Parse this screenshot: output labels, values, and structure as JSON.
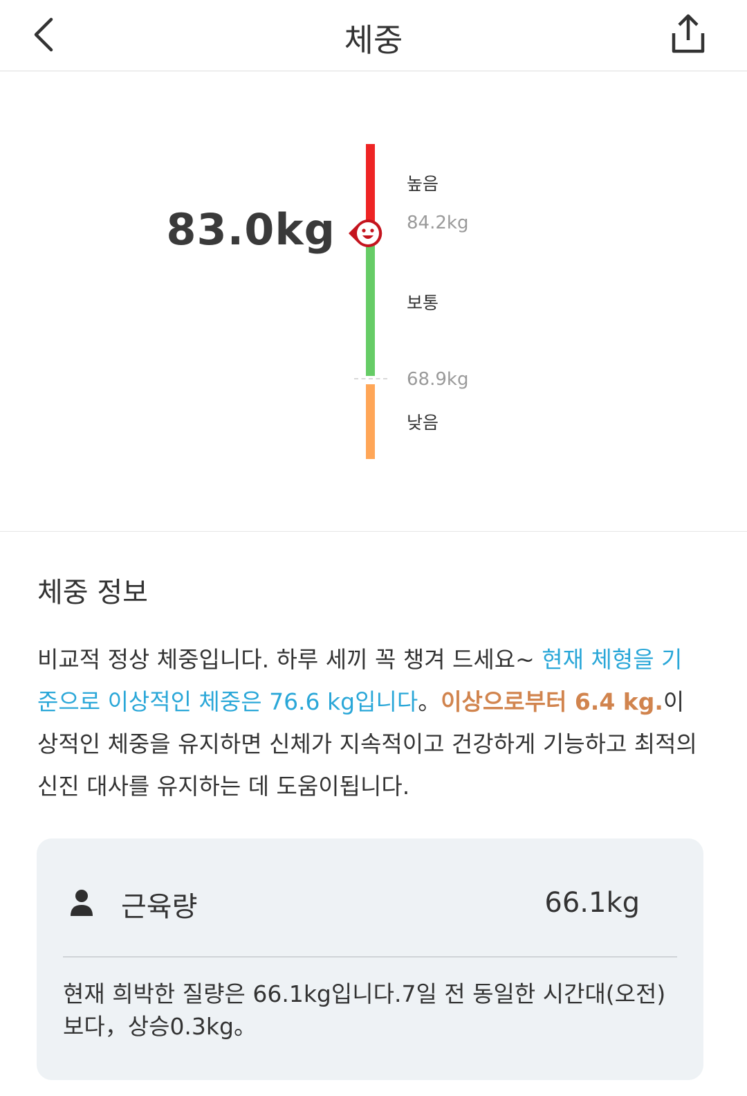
{
  "header": {
    "title": "체중",
    "back_icon": "chevron-left-icon",
    "share_icon": "share-icon"
  },
  "gauge": {
    "current_weight": "83.0kg",
    "zones": {
      "high": "높음",
      "normal": "보통",
      "low": "낮음"
    },
    "thresholds": {
      "upper": "84.2kg",
      "lower": "68.9kg"
    },
    "colors": {
      "high": "#ee2424",
      "normal": "#66cc66",
      "low": "#ffa657",
      "marker": "#c4141e"
    }
  },
  "info": {
    "title": "체중 정보",
    "text_plain_1": "비교적 정상 체중입니다. 하루 세끼 꼭 챙겨 드세요~ ",
    "text_blue": "현재 체형을 기준으로 이상적인 체중은 76.6 kg입니다",
    "text_plain_2": "。",
    "text_orange": "이상으로부터 6.4 kg.",
    "text_plain_3": "이상적인 체중을 유지하면 신체가 지속적이고 건강하게 기능하고 최적의 신진 대사를 유지하는 데 도움이됩니다."
  },
  "muscle_card": {
    "icon": "person-icon",
    "label": "근육량",
    "value": "66.1kg",
    "description": "현재 희박한 질량은 66.1kg입니다.7일 전 동일한 시간대(오전)보다，상승0.3kg。"
  }
}
